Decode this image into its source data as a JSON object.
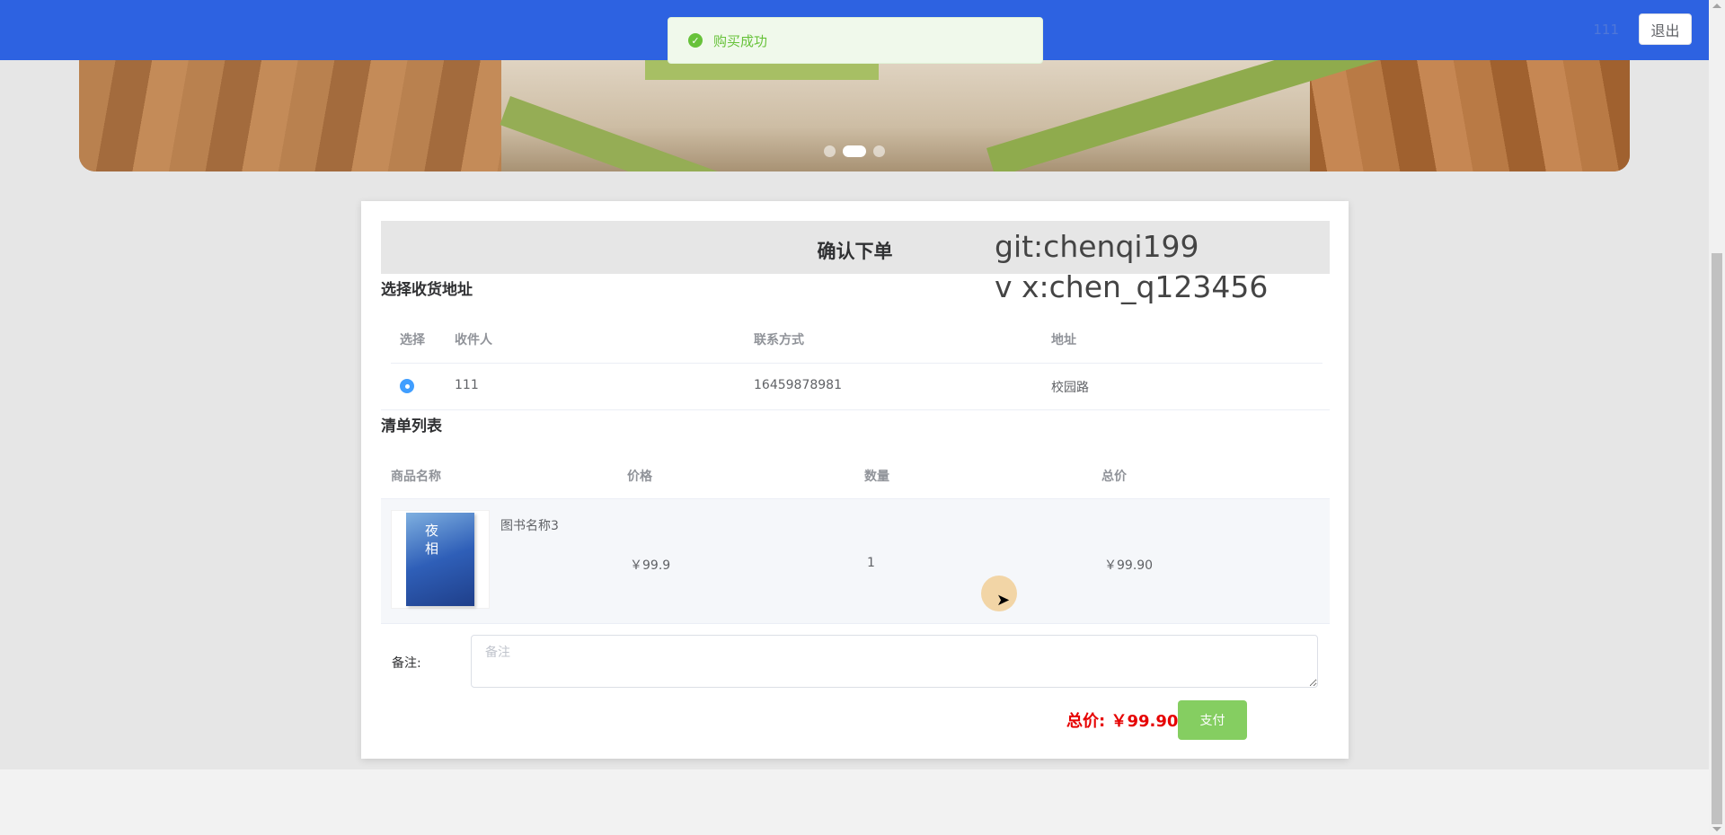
{
  "header": {
    "user_name": "111",
    "logout_label": "退出",
    "brand_color": "#2d62e1"
  },
  "toast": {
    "message": "购买成功",
    "icon": "check-circle-icon",
    "color": "#67c23a"
  },
  "carousel": {
    "slide_count": 3,
    "active_index": 1
  },
  "order": {
    "title": "确认下单",
    "watermark_line1": "git:chenqi199",
    "watermark_line2": "v x:chen_q123456",
    "address_section": {
      "title": "选择收货地址",
      "columns": [
        "选择",
        "收件人",
        "联系方式",
        "地址"
      ],
      "rows": [
        {
          "selected": true,
          "recipient": "111",
          "phone": "16459878981",
          "address": "校园路"
        }
      ]
    },
    "items_section": {
      "title": "清单列表",
      "columns": [
        "商品名称",
        "价格",
        "数量",
        "总价"
      ],
      "rows": [
        {
          "name": "图书名称3",
          "cover_text": "夜 相",
          "price": "￥99.9",
          "quantity": "1",
          "subtotal": "￥99.90"
        }
      ]
    },
    "remark": {
      "label": "备注:",
      "placeholder": "备注",
      "value": ""
    },
    "total_label": "总价:",
    "total_value": "￥99.90",
    "pay_label": "支付",
    "pay_color": "#85ce61",
    "total_color": "#e60000"
  }
}
